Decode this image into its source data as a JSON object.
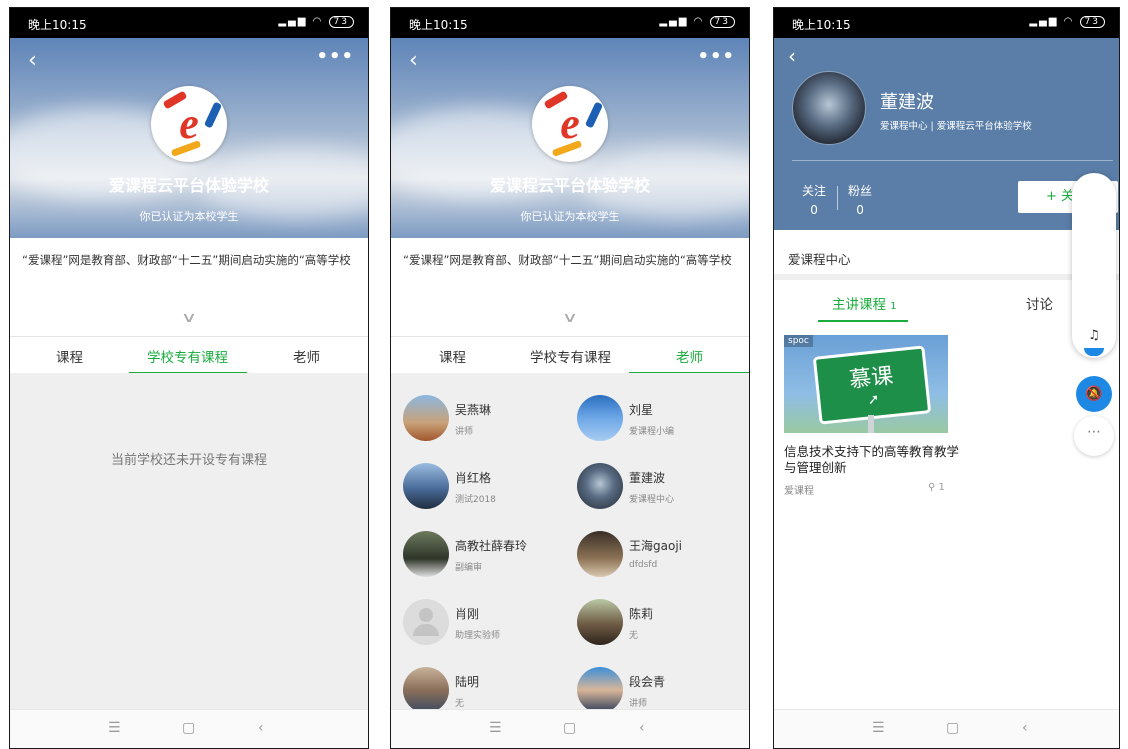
{
  "status": {
    "time": "晚上10:15",
    "signal": "...",
    "battery": "73"
  },
  "school": {
    "back_icon": "back-chevron-icon",
    "more": "•••",
    "name": "爱课程云平台体验学校",
    "verified": "你已认证为本校学生",
    "intro": "“爱课程”网是教育部、财政部“十二五”期间启动实施的“高等学校",
    "expand_icon": "chevron-down-icon",
    "tabs": [
      "课程",
      "学校专有课程",
      "老师"
    ],
    "empty_message": "当前学校还未开设专有课程"
  },
  "teachers": [
    {
      "name": "吴燕琳",
      "role": "讲师",
      "avatar_color": "#c9a27a"
    },
    {
      "name": "刘星",
      "role": "爱课程小编",
      "avatar_color": "#4f8fd8"
    },
    {
      "name": "肖红格",
      "role": "测试2018",
      "avatar_color": "#6d8bb3"
    },
    {
      "name": "董建波",
      "role": "爱课程中心",
      "avatar_color": "#3b4656"
    },
    {
      "name": "高教社薛春玲",
      "role": "副编审",
      "avatar_color": "#3f4a3c"
    },
    {
      "name": "王海gaoji",
      "role": "dfdsfd",
      "avatar_color": "#5a4a3a"
    },
    {
      "name": "肖刚",
      "role": "助理实验师",
      "avatar_color": "#dcdcdc"
    },
    {
      "name": "陈莉",
      "role": "无",
      "avatar_color": "#7a6a55"
    },
    {
      "name": "陆明",
      "role": "无",
      "avatar_color": "#8a6f5a"
    },
    {
      "name": "段会青",
      "role": "讲师",
      "avatar_color": "#3d8ed8"
    }
  ],
  "profile": {
    "name": "董建波",
    "org": "爱课程中心 | 爱课程云平台体验学校",
    "follow_label": "关注",
    "follow_count": "0",
    "fans_label": "粉丝",
    "fans_count": "0",
    "follow_button": "+ 关",
    "section": "爱课程中心",
    "tab_courses": "主讲课程",
    "tab_courses_count": "1",
    "tab_discuss": "讨论",
    "course": {
      "tag": "spoc",
      "sign_text": "慕课",
      "title": "信息技术支持下的高等教育教学与管理创新",
      "provider": "爱课程",
      "learners": "1"
    }
  },
  "nav": {
    "menu": "☰",
    "home": "▢",
    "back": "‹"
  },
  "colors": {
    "accent_green": "#1aac3d",
    "header_blue": "#5a7ea7",
    "float_blue": "#1e88e5"
  }
}
